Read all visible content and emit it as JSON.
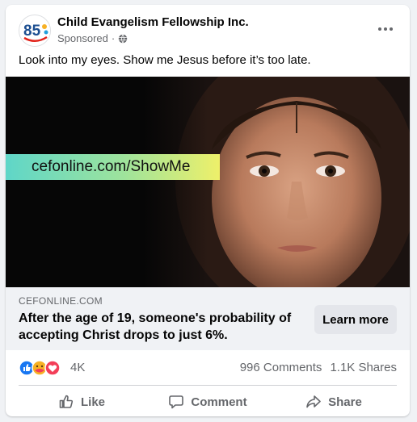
{
  "post": {
    "page_name": "Child Evangelism Fellowship Inc.",
    "sponsored_label": "Sponsored",
    "separator": "·",
    "avatar_text": "85",
    "text": "Look into my eyes. Show me Jesus before it’s too late.",
    "media": {
      "banner_text": "cefonline.com/ShowMe"
    },
    "link": {
      "domain": "CEFONLINE.COM",
      "headline": "After the age of 19, someone's probability of accepting Christ drops to just 6%.",
      "cta_label": "Learn more"
    },
    "reactions": {
      "count": "4K",
      "comments": "996 Comments",
      "shares": "1.1K Shares",
      "types": [
        "like-icon",
        "care-icon",
        "love-icon"
      ]
    },
    "actions": {
      "like": "Like",
      "comment": "Comment",
      "share": "Share"
    }
  },
  "colors": {
    "background": "#f0f2f5",
    "like_blue": "#1877f2",
    "love_red": "#f33e58",
    "care_yellow": "#f7b125",
    "text_secondary": "#65676b"
  }
}
